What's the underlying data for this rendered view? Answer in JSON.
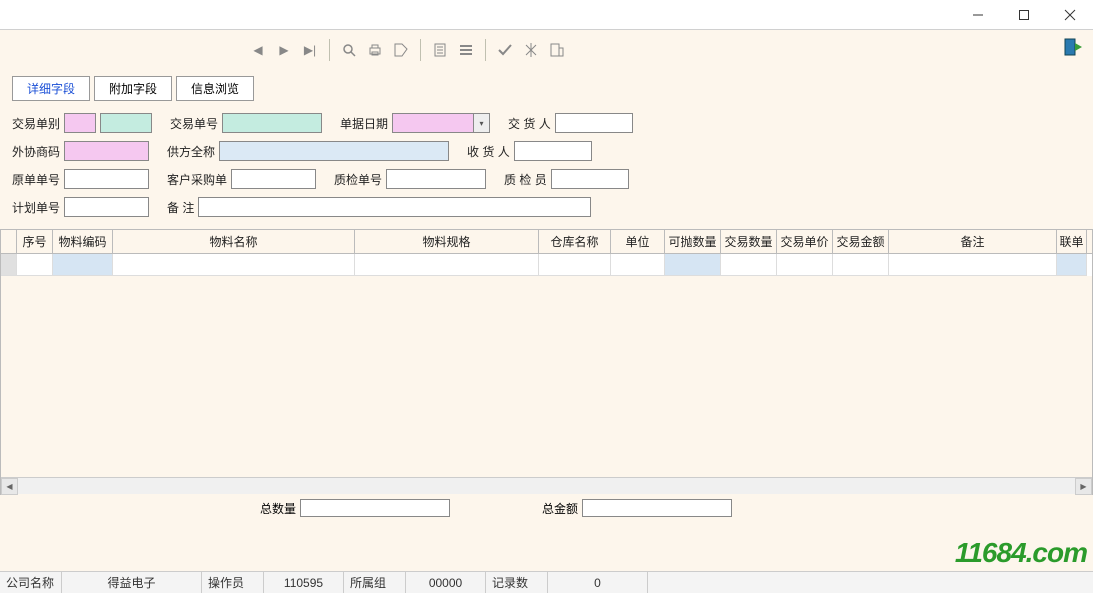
{
  "tabs": {
    "t0": "详细字段",
    "t1": "附加字段",
    "t2": "信息浏览"
  },
  "labels": {
    "tx_type": "交易单别",
    "tx_no": "交易单号",
    "doc_date": "单据日期",
    "deliverer": "交 货 人",
    "supplier_code": "外协商码",
    "supplier_name": "供方全称",
    "receiver": "收 货 人",
    "orig_no": "原单单号",
    "cust_po": "客户采购单",
    "qc_no": "质检单号",
    "qc_person": "质 检 员",
    "plan_no": "计划单号",
    "remark": "备    注"
  },
  "grid": {
    "cols": [
      "序号",
      "物料编码",
      "物料名称",
      "物料规格",
      "仓库名称",
      "单位",
      "可抛数量",
      "交易数量",
      "交易单价",
      "交易金额",
      "备注",
      "联单"
    ]
  },
  "totals": {
    "qty_label": "总数量",
    "amt_label": "总金额"
  },
  "status": {
    "company_label": "公司名称",
    "company_value": "得益电子",
    "operator_label": "操作员",
    "operator_value": "110595",
    "group_label": "所属组",
    "group_value": "00000",
    "records_label": "记录数",
    "records_value": "0"
  },
  "watermark": "11684.com"
}
